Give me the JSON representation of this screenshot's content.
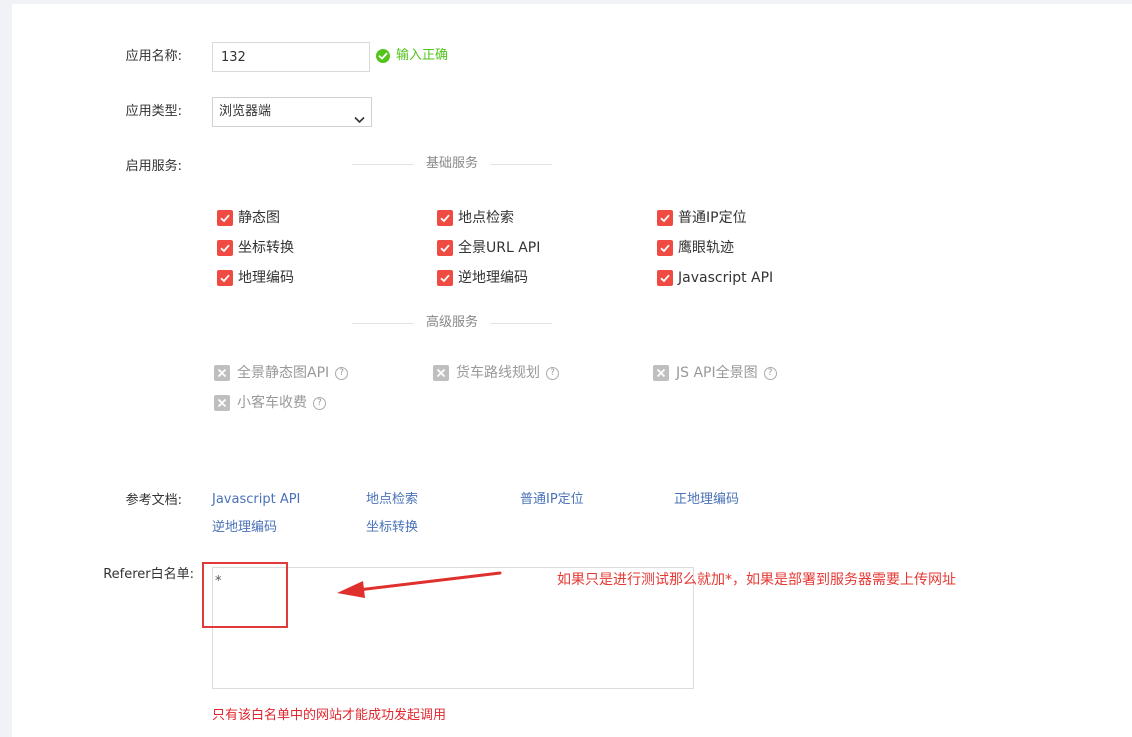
{
  "form": {
    "app_name_label": "应用名称:",
    "app_name_value": "132",
    "app_name_valid": "输入正确",
    "app_type_label": "应用类型:",
    "app_type_value": "浏览器端",
    "services_label": "启用服务:",
    "doc_label": "参考文档:",
    "referer_label": "Referer白名单:",
    "referer_value": "*",
    "referer_hint": "只有该白名单中的网站才能成功发起调用"
  },
  "basic_services": {
    "title": "基础服务",
    "items": [
      {
        "label": "静态图",
        "checked": true
      },
      {
        "label": "地点检索",
        "checked": true
      },
      {
        "label": "普通IP定位",
        "checked": true
      },
      {
        "label": "坐标转换",
        "checked": true
      },
      {
        "label": "全景URL API",
        "checked": true
      },
      {
        "label": "鹰眼轨迹",
        "checked": true
      },
      {
        "label": "地理编码",
        "checked": true
      },
      {
        "label": "逆地理编码",
        "checked": true
      },
      {
        "label": "Javascript API",
        "checked": true
      }
    ]
  },
  "advanced_services": {
    "title": "高级服务",
    "items": [
      {
        "label": "全景静态图API",
        "enabled": false
      },
      {
        "label": "货车路线规划",
        "enabled": false
      },
      {
        "label": "JS API全景图",
        "enabled": false
      },
      {
        "label": "小客车收费",
        "enabled": false
      }
    ]
  },
  "docs": [
    "Javascript API",
    "地点检索",
    "普通IP定位",
    "正地理编码",
    "逆地理编码",
    "坐标转换"
  ],
  "annotation": {
    "text": "如果只是进行测试那么就加*，如果是部署到服务器需要上传网址"
  },
  "colors": {
    "checkbox": "#f04b42",
    "valid": "#52c41a",
    "link": "#4a72b8",
    "annotation": "#e53935",
    "hint": "#e0262d"
  }
}
